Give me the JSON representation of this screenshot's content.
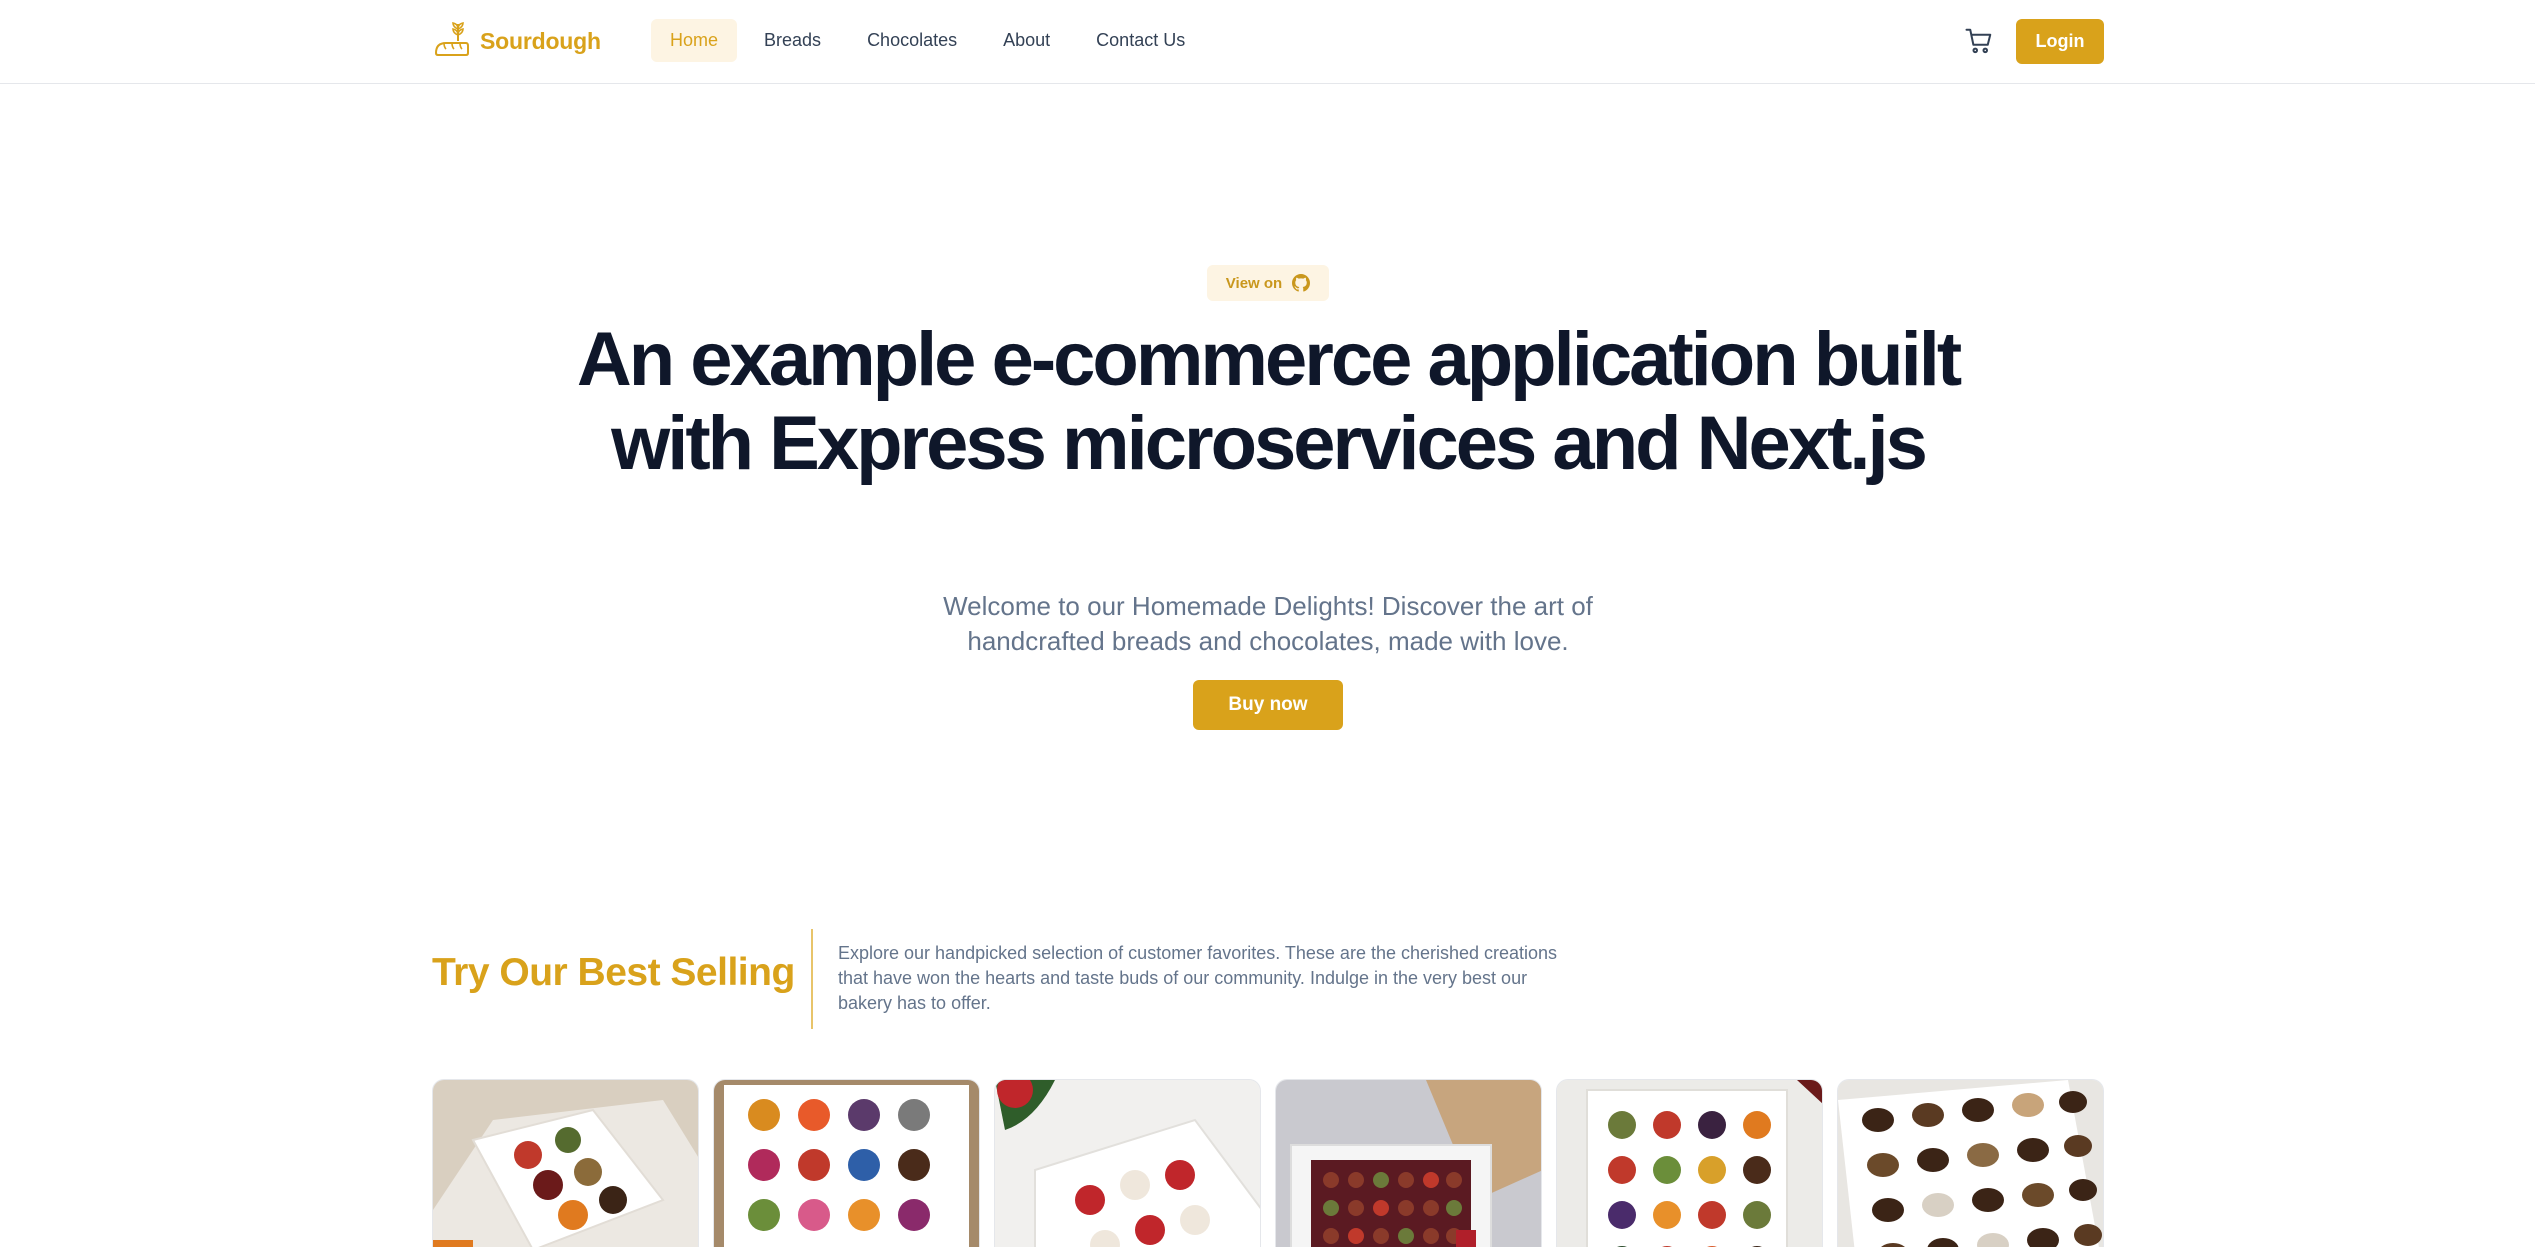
{
  "brand": {
    "name": "Sourdough",
    "color": "#d9a21b",
    "logo_icon": "wheat-bread-logo-icon"
  },
  "nav": {
    "items": [
      {
        "label": "Home",
        "active": true
      },
      {
        "label": "Breads",
        "active": false
      },
      {
        "label": "Chocolates",
        "active": false
      },
      {
        "label": "About",
        "active": false
      },
      {
        "label": "Contact Us",
        "active": false
      }
    ]
  },
  "header": {
    "cart_icon": "shopping-cart-icon",
    "login_label": "Login"
  },
  "hero": {
    "badge_text": "View on",
    "badge_icon": "github-icon",
    "title": "An example e-commerce application built with Express microservices and Next.js",
    "subtitle": "Welcome to our Homemade Delights! Discover the art of handcrafted breads and chocolates, made with love.",
    "cta_label": "Buy now"
  },
  "best_selling": {
    "title": "Try Our Best Selling",
    "description": "Explore our handpicked selection of customer favorites. These are the cherished creations that have won the hearts and taste buds of our community. Indulge in the very best our bakery has to offer.",
    "products": [
      {
        "image": "chocolate-box-6-assorted"
      },
      {
        "image": "chocolate-box-colorful-bonbons"
      },
      {
        "image": "chocolate-box-red-hearts"
      },
      {
        "image": "chocolate-box-gift-bag"
      },
      {
        "image": "chocolate-box-16-assorted"
      },
      {
        "image": "chocolate-box-dark-nuts"
      }
    ]
  },
  "colors": {
    "accent": "#d9a21b",
    "accent_soft": "#fdf4e3",
    "heading": "#0f172a",
    "muted": "#64748b"
  }
}
